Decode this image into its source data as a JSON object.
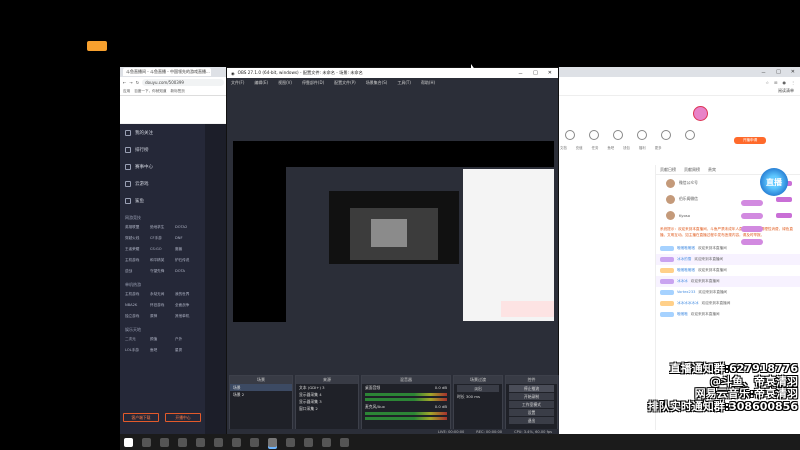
{
  "left_browser": {
    "tab_title": "斗鱼直播间 - 斗鱼直播 - 中国领先的游戏直播...",
    "url": "douyu.com/500399",
    "bookmarks": [
      "应用",
      "百度一下，你就知道",
      "新标签页"
    ]
  },
  "sidebar": {
    "items": [
      "我的关注",
      "排行榜",
      "赛事中心",
      "云游戏",
      "鲨鱼"
    ],
    "section_hot": "网游竞技",
    "hot_games": [
      "英雄联盟",
      "绝地求生",
      "DOTA2",
      "穿越火线",
      "CF手游",
      "DNF",
      "王者荣耀",
      "CS:GO",
      "魔兽",
      "主机游戏",
      "和平精英",
      "炉石传说",
      "逆战",
      "守望先锋",
      "DOTA",
      "魔兽世界",
      "炉石",
      "APEX英雄"
    ],
    "section_single": "单机热游",
    "single_games": [
      "主机游戏",
      "永劫无间",
      "我的世界",
      "NBA2K",
      "怀旧游戏",
      "全面战争",
      "独立游戏",
      "原神",
      "其他单机"
    ],
    "section_fun": "娱乐天地",
    "fun_items": [
      "二次元",
      "颜值",
      "户外",
      "LOL手游",
      "鱼吧",
      "星秀",
      "音乐",
      "户外",
      "二次元"
    ],
    "btn_client": "客户端下载",
    "btn_open": "开播中心"
  },
  "obs": {
    "title": "OBS 27.1.0 (64-bit, windows) - 配置文件: 未命名 - 场景: 未命名",
    "menu": [
      "文件(F)",
      "编辑(E)",
      "视图(V)",
      "停靠部件(D)",
      "配置文件(P)",
      "场景集合(S)",
      "工具(T)",
      "帮助(H)"
    ],
    "docks": {
      "scenes_header": "场景",
      "scenes": [
        "场景",
        "场景 2"
      ],
      "sources_header": "来源",
      "sources": [
        "文本 (GDI+) 3",
        "显示器采集 4",
        "显示器采集 3",
        "窗口采集 2"
      ],
      "mixer_header": "混音器",
      "mixer": [
        "桌面音频",
        "麦克风/Aux"
      ],
      "mixer_db": [
        "0.0 dB",
        "0.0 dB"
      ],
      "transitions_header": "场景过渡",
      "transition_value": "淡出",
      "duration_label": "时长",
      "duration_value": "300 ms",
      "controls_header": "控件",
      "controls": [
        "停止推流",
        "开始录制",
        "工作室模式",
        "设置",
        "退出"
      ]
    },
    "status": [
      "LIVE: 00:00:00",
      "REC: 00:00:00",
      "CPU: 3.4%, 60.00 fps"
    ]
  },
  "right_browser": {
    "top_controls": [
      "－",
      "□",
      "✕"
    ],
    "bookmark_right": "阅读清单",
    "nav_labels": [
      "文档",
      "充值",
      "任务",
      "鱼吧",
      "钱包",
      "福利",
      "更多"
    ],
    "open_btn": "开播申请",
    "chat_tabs": [
      "贡献日榜",
      "贡献周榜",
      "贵宾"
    ],
    "ranks": [
      "微信公众号",
      "伯乐阁微信",
      "Kyoso"
    ],
    "notice": "系统提示：欢迎来到本直播间，斗鱼严禁未成年人直播或打赏，请理性消费，绿色直播，文明互动。如主播在直播过程中发布违规内容，请及时举报。",
    "messages": [
      {
        "name": "嗷嗷嗷嗷嗷",
        "text": "欢迎来到本直播间"
      },
      {
        "name": "冰冰的雪",
        "text": "欢迎来到本直播间"
      },
      {
        "name": "嗷嗷嗷嗷嗷",
        "text": "欢迎来到本直播间"
      },
      {
        "name": "冰冰冰",
        "text": "欢迎来到本直播间"
      },
      {
        "name": "Vortex233",
        "text": "欢迎来到本直播间"
      },
      {
        "name": "冰冰冰冰冰冰",
        "text": "欢迎来到本直播间"
      },
      {
        "name": "嗷嗷嗷",
        "text": "欢迎来到本直播间"
      }
    ],
    "float_badge": "直播"
  },
  "overlay": {
    "line1": "直播通知群:627918776",
    "line2": "@斗鱼、帝哀清羽",
    "line3": "网易云音乐:帝哀清羽",
    "line4": "排队实时通知群:308600856"
  },
  "colors": {
    "obs_bg": "#2b2e38",
    "sidebar_bg": "#252838",
    "accent_orange": "#ff6a2b",
    "overlay_text": "#ffffff"
  }
}
